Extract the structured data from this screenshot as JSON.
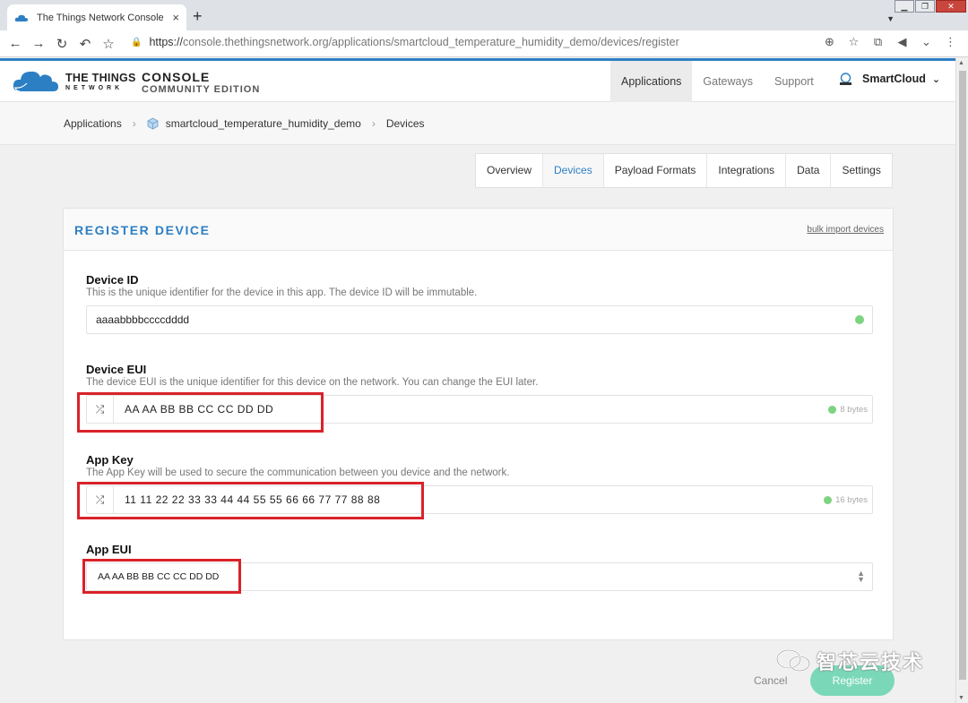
{
  "browser": {
    "tab_title": "The Things Network Console",
    "tab_close": "×",
    "new_tab": "+",
    "url_scheme": "https://",
    "url_rest": "console.thethingsnetwork.org/applications/smartcloud_temperature_humidity_demo/devices/register"
  },
  "header": {
    "brand_top": "THE THINGS",
    "brand_bottom": "NETWORK",
    "console_title": "CONSOLE",
    "console_edition": "COMMUNITY EDITION",
    "nav": [
      "Applications",
      "Gateways",
      "Support"
    ],
    "user_name": "SmartCloud"
  },
  "breadcrumb": {
    "root": "Applications",
    "app": "smartcloud_temperature_humidity_demo",
    "current": "Devices"
  },
  "subnav": {
    "tabs": [
      "Overview",
      "Devices",
      "Payload Formats",
      "Integrations",
      "Data",
      "Settings"
    ],
    "active": "Devices"
  },
  "card": {
    "title": "REGISTER DEVICE",
    "bulk_link": "bulk import devices"
  },
  "fields": {
    "device_id": {
      "label": "Device ID",
      "desc": "This is the unique identifier for the device in this app. The device ID will be immutable.",
      "value": "aaaabbbbccccdddd"
    },
    "device_eui": {
      "label": "Device EUI",
      "desc": "The device EUI is the unique identifier for this device on the network. You can change the EUI later.",
      "value": "AA AA BB BB CC CC DD DD",
      "bytes": "8 bytes"
    },
    "app_key": {
      "label": "App Key",
      "desc": "The App Key will be used to secure the communication between you device and the network.",
      "value": "11 11 22 22 33 33 44 44 55 55 66 66 77 77 88 88",
      "bytes": "16 bytes"
    },
    "app_eui": {
      "label": "App EUI",
      "value": "AA AA BB BB CC CC DD DD"
    }
  },
  "actions": {
    "cancel": "Cancel",
    "register": "Register"
  },
  "watermark": "智芯云技术",
  "colors": {
    "accent": "#2d7fc4",
    "register_btn": "#7ad8b8",
    "highlight": "#d9222a",
    "ok": "#7cd381"
  }
}
